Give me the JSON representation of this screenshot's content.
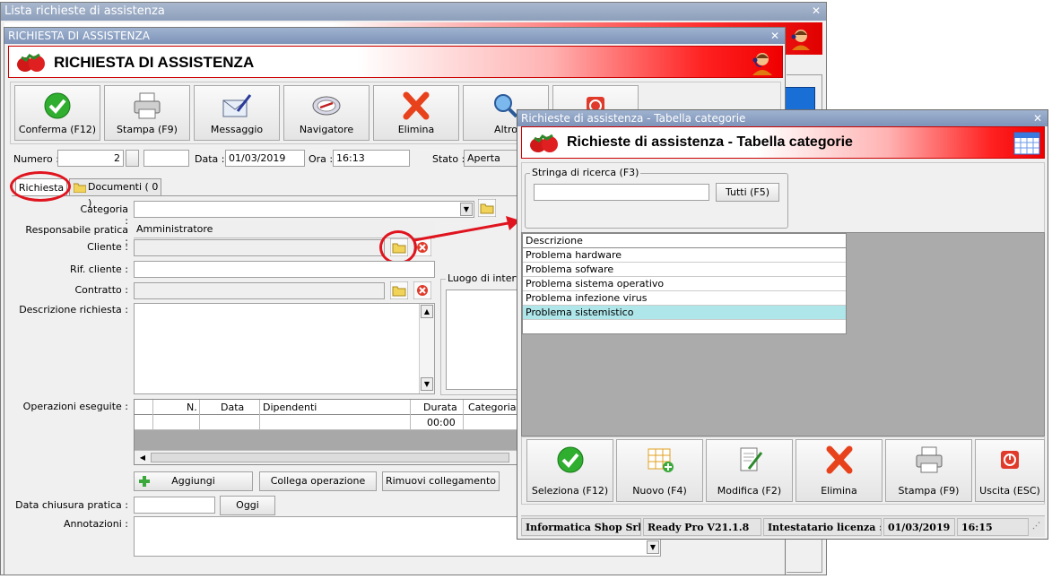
{
  "back_window": {
    "title": "Lista richieste di assistenza"
  },
  "main_window": {
    "title": "RICHIESTA DI ASSISTENZA",
    "banner_title": "RICHIESTA DI ASSISTENZA",
    "toolbar": {
      "confirm": "Conferma (F12)",
      "print": "Stampa (F9)",
      "message": "Messaggio",
      "navigator": "Navigatore",
      "delete": "Elimina",
      "other": "Altro"
    },
    "header": {
      "number_label": "Numero :",
      "number_value": "2",
      "number_value2": "",
      "date_label": "Data :",
      "date_value": "01/03/2019",
      "time_label": "Ora :",
      "time_value": "16:13",
      "state_label": "Stato :",
      "state_value": "Aperta"
    },
    "tabs": [
      "Richiesta",
      "Documenti ( 0 )"
    ],
    "form": {
      "category_label": "Categoria :",
      "category_value": "",
      "owner_label": "Responsabile pratica :",
      "owner_value": "Amministratore",
      "client_label": "Cliente :",
      "client_value": "",
      "client_ref_label": "Rif. cliente :",
      "client_ref_value": "",
      "contract_label": "Contratto :",
      "contract_value": "",
      "description_label": "Descrizione richiesta :",
      "description_value": "",
      "place_label": "Luogo di interve",
      "operations_label": "Operazioni eseguite :",
      "ops_columns": [
        "N.",
        "Data",
        "Dipendenti",
        "Durata",
        "Categoria"
      ],
      "ops_row": {
        "duration": "00:00"
      },
      "add_button": "Aggiungi",
      "link_button": "Collega operazione",
      "unlink_button": "Rimuovi collegamento",
      "close_date_label": "Data chiusura pratica :",
      "close_date_value": "",
      "today_button": "Oggi",
      "notes_label": "Annotazioni :",
      "notes_value": ""
    }
  },
  "dialog": {
    "title": "Richieste di assistenza - Tabella categorie",
    "banner_title": "Richieste di assistenza - Tabella categorie",
    "search_group": "Stringa di ricerca (F3)",
    "search_value": "",
    "all_button": "Tutti (F5)",
    "list_header": "Descrizione",
    "items": [
      "Problema hardware",
      "Problema sofware",
      "Problema sistema operativo",
      "Problema infezione virus",
      "Problema sistemistico"
    ],
    "selected_index": 4,
    "buttons": {
      "select": "Seleziona (F12)",
      "new": "Nuovo (F4)",
      "edit": "Modifica (F2)",
      "delete": "Elimina",
      "print": "Stampa (F9)",
      "exit": "Uscita (ESC)"
    },
    "status": {
      "company": "Informatica Shop Srl",
      "version": "Ready Pro V21.1.8",
      "license": "Intestatario licenza : C",
      "date": "01/03/2019",
      "time": "16:15"
    }
  },
  "colors": {
    "selected_row": "#aee6ea",
    "banner_red": "#f00000",
    "annotation_red": "#e0141e"
  }
}
